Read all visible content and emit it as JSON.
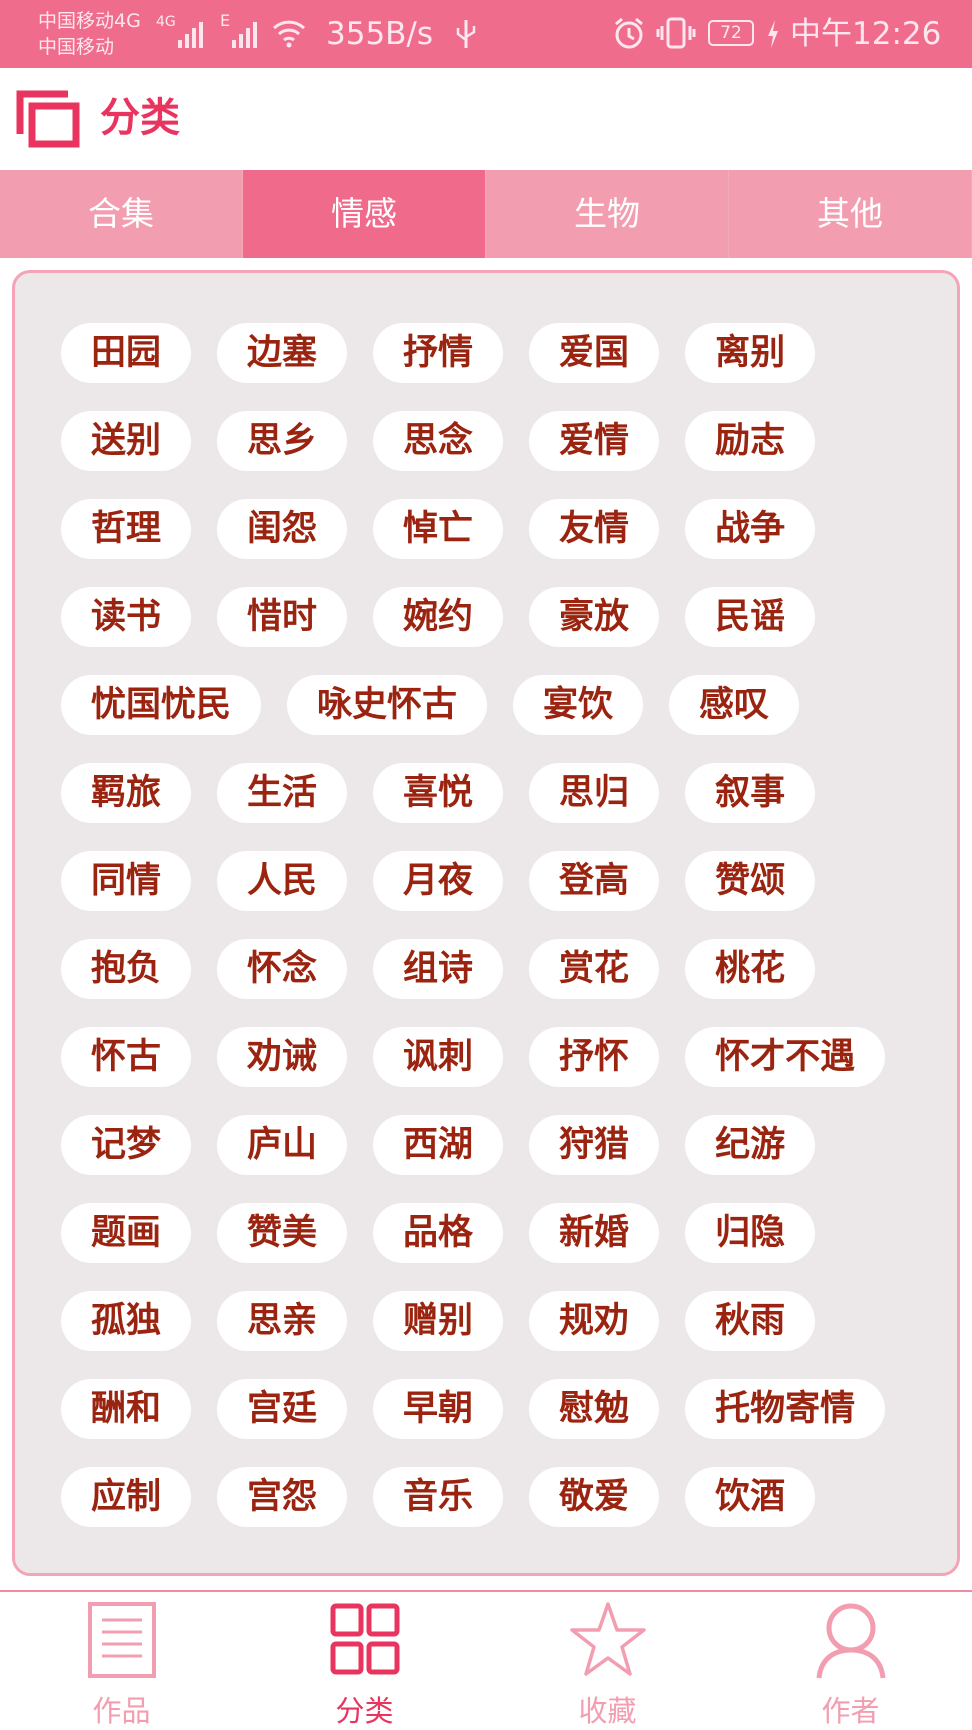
{
  "status_bar": {
    "carrier_1": "中国移动4G",
    "carrier_2": "中国移动",
    "net_4g": "4G",
    "net_e": "E",
    "speed": "355B/s",
    "battery": "72",
    "time": "中午12:26"
  },
  "header": {
    "title": "分类",
    "icon": "category-square-icon"
  },
  "tabs": [
    {
      "label": "合集",
      "active": false
    },
    {
      "label": "情感",
      "active": true
    },
    {
      "label": "生物",
      "active": false
    },
    {
      "label": "其他",
      "active": false
    }
  ],
  "tag_rows": [
    [
      "田园",
      "边塞",
      "抒情",
      "爱国",
      "离别"
    ],
    [
      "送别",
      "思乡",
      "思念",
      "爱情",
      "励志"
    ],
    [
      "哲理",
      "闺怨",
      "悼亡",
      "友情",
      "战争"
    ],
    [
      "读书",
      "惜时",
      "婉约",
      "豪放",
      "民谣"
    ],
    [
      "忧国忧民",
      "咏史怀古",
      "宴饮",
      "感叹"
    ],
    [
      "羁旅",
      "生活",
      "喜悦",
      "思归",
      "叙事"
    ],
    [
      "同情",
      "人民",
      "月夜",
      "登高",
      "赞颂"
    ],
    [
      "抱负",
      "怀念",
      "组诗",
      "赏花",
      "桃花"
    ],
    [
      "怀古",
      "劝诫",
      "讽刺",
      "抒怀",
      "怀才不遇"
    ],
    [
      "记梦",
      "庐山",
      "西湖",
      "狩猎",
      "纪游"
    ],
    [
      "题画",
      "赞美",
      "品格",
      "新婚",
      "归隐"
    ],
    [
      "孤独",
      "思亲",
      "赠别",
      "规劝",
      "秋雨"
    ],
    [
      "酬和",
      "宫廷",
      "早朝",
      "慰勉",
      "托物寄情"
    ],
    [
      "应制",
      "宫怨",
      "音乐",
      "敬爱",
      "饮酒"
    ]
  ],
  "bottom_nav": [
    {
      "label": "作品",
      "icon": "document-list-icon",
      "active": false
    },
    {
      "label": "分类",
      "icon": "grid-icon",
      "active": true
    },
    {
      "label": "收藏",
      "icon": "star-icon",
      "active": false
    },
    {
      "label": "作者",
      "icon": "person-icon",
      "active": false
    }
  ],
  "colors": {
    "accent": "#e8345e",
    "status_bar": "#f06c8c",
    "tab_bar": "#f39db0",
    "tab_active": "#f06a8b",
    "panel_bg": "#ece8ea",
    "tag_text": "#9b2410"
  }
}
